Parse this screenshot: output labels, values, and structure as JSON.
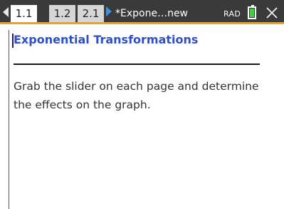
{
  "toolbar": {
    "tabs": [
      {
        "label": "1.1",
        "active": true
      },
      {
        "label": "1.2",
        "active": false
      },
      {
        "label": "2.1",
        "active": false
      }
    ],
    "document_title": "*Expone…new",
    "angle_mode": "RAD",
    "battery_color": "#3bd23b",
    "accent_color": "#f4a300",
    "icons": {
      "prev": "left-arrow-icon",
      "next": "right-arrow-icon",
      "battery": "battery-icon",
      "close": "close-icon"
    }
  },
  "page": {
    "title": "Exponential Transformations",
    "title_color": "#2f4fc4",
    "body": "Grab the slider on each page and determine the effects on the graph."
  }
}
